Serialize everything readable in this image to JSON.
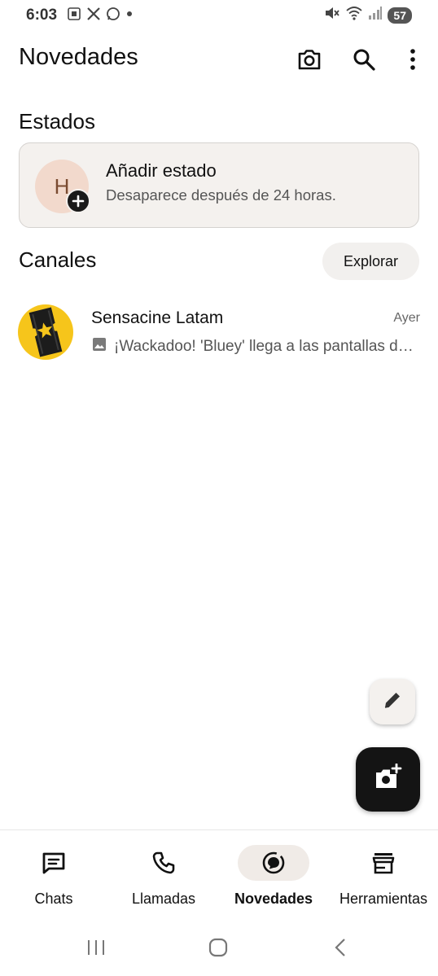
{
  "status_bar": {
    "time": "6:03",
    "battery": "57",
    "left_icons": [
      "screenshot-icon",
      "x-icon",
      "whatsapp-icon",
      "dot-icon"
    ],
    "right_icons": [
      "mute-icon",
      "wifi-icon",
      "signal-icon"
    ]
  },
  "header": {
    "title": "Novedades",
    "icons": [
      "camera-icon",
      "search-icon",
      "more-vert-icon"
    ]
  },
  "estados": {
    "section_title": "Estados",
    "card": {
      "avatar_letter": "H",
      "title": "Añadir estado",
      "subtitle": "Desaparece después de 24 horas."
    }
  },
  "canales": {
    "section_title": "Canales",
    "explore_label": "Explorar",
    "channels": [
      {
        "name": "Sensacine Latam",
        "time": "Ayer",
        "preview": "¡Wackadoo! 'Bluey' llega a las pantallas de cine"
      }
    ]
  },
  "bottom_nav": {
    "items": [
      {
        "label": "Chats",
        "icon": "chats-icon",
        "active": false
      },
      {
        "label": "Llamadas",
        "icon": "phone-icon",
        "active": false
      },
      {
        "label": "Novedades",
        "icon": "updates-icon",
        "active": true
      },
      {
        "label": "Herramientas",
        "icon": "store-icon",
        "active": false
      }
    ]
  },
  "colors": {
    "card_bg": "#f4f1ee",
    "avatar_bg": "#f2d9cc",
    "channel_avatar_bg": "#f6c51b",
    "fab_dark": "#141414",
    "active_nav_bg": "#f0ebe7"
  }
}
